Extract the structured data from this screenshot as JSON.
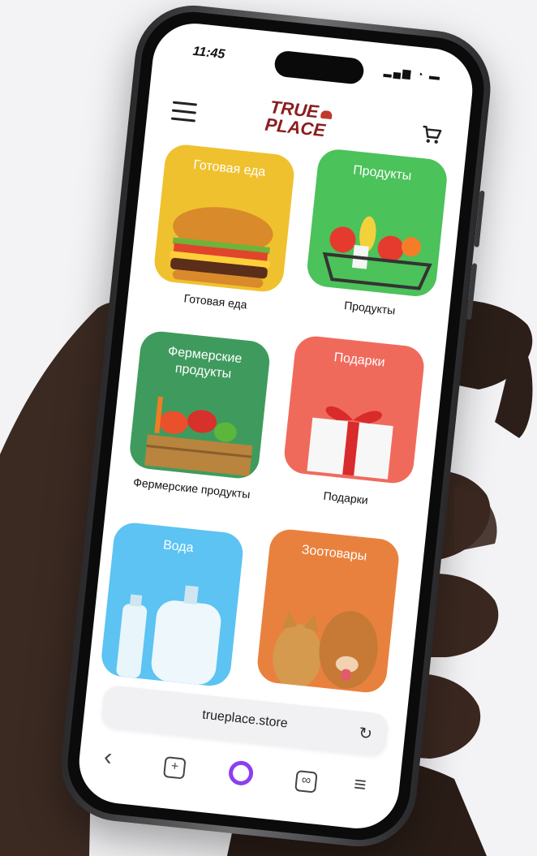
{
  "status": {
    "time": "11:45",
    "icons": "▂▄▆ ◔ ▬"
  },
  "header": {
    "logo_line1": "TRUE",
    "logo_line2": "PLACE"
  },
  "tiles": [
    {
      "title": "Готовая еда",
      "caption": "Готовая еда",
      "color": "#f0c12f"
    },
    {
      "title": "Продукты",
      "caption": "Продукты",
      "color": "#4cc25a"
    },
    {
      "title": "Фермерские продукты",
      "caption": "Фермерские продукты",
      "color": "#3f9b5d"
    },
    {
      "title": "Подарки",
      "caption": "Подарки",
      "color": "#f06a5c"
    },
    {
      "title": "Вода",
      "caption": "",
      "color": "#5cc3f2"
    },
    {
      "title": "Зоотовары",
      "caption": "",
      "color": "#e9813e"
    }
  ],
  "browser": {
    "url": "trueplace.store",
    "reload_icon": "↻",
    "back_icon": "‹",
    "new_tab_icon": "+",
    "tabs_icon": "∞",
    "menu_icon": "≡"
  }
}
